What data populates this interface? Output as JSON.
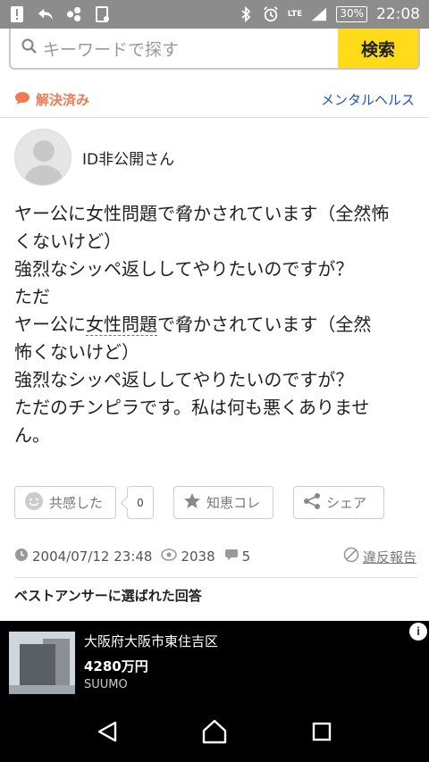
{
  "status_bar": {
    "lte": "LTE",
    "battery": "30%",
    "time": "22:08"
  },
  "search": {
    "placeholder": "キーワードで探す",
    "button_label": "検索"
  },
  "question_header": {
    "status": "解決済み",
    "category": "メンタルヘルス"
  },
  "question": {
    "user": "ID非公開さん",
    "lines": [
      "ヤー公に女性問題で脅かされています（全然怖",
      "くないけど）",
      "強烈なシッペ返ししてやりたいのですが？",
      "ただ",
      "ヤー公に",
      "女性問題",
      "で脅かされています（全然",
      "怖くないけど）",
      "強烈なシッペ返ししてやりたいのですが？",
      "ただのチンピラです。私は何も悪くありませ",
      "ん。"
    ],
    "empathy_label": "共感した",
    "empathy_count": "0",
    "chie_label": "知恵コレ",
    "share_label": "シェア",
    "date": "2004/07/12 23:48",
    "views": "2038",
    "answers": "5",
    "report_label": "違反報告"
  },
  "best_answer_heading": "ベストアンサーに選ばれた回答",
  "ad": {
    "title": "大阪府大阪市東住吉区",
    "price": "4280万円",
    "brand": "SUUMO"
  },
  "colors": {
    "search_button": "#ffdb1a",
    "resolved": "#f07a54",
    "link": "#1a56c2"
  }
}
